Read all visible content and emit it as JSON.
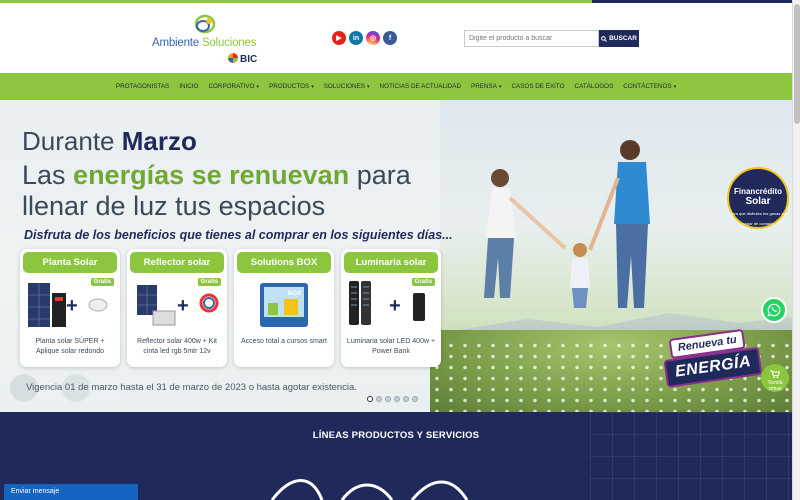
{
  "header": {
    "logo_text_part1": "Ambiente ",
    "logo_text_part2": "Soluciones",
    "logo_sub": "BIC",
    "social": [
      {
        "icon": "youtube-icon",
        "glyph": "▶"
      },
      {
        "icon": "linkedin-icon",
        "glyph": "in"
      },
      {
        "icon": "instagram-icon",
        "glyph": "◎"
      },
      {
        "icon": "facebook-icon",
        "glyph": "f"
      }
    ],
    "search": {
      "placeholder": "Digite el producto a buscar",
      "button_label": "BUSCAR"
    }
  },
  "nav": [
    {
      "label": "PROTAGONISTAS",
      "dropdown": false
    },
    {
      "label": "INICIO",
      "dropdown": false
    },
    {
      "label": "CORPORATIVO",
      "dropdown": true
    },
    {
      "label": "PRODUCTOS",
      "dropdown": true
    },
    {
      "label": "SOLUCIONES",
      "dropdown": true
    },
    {
      "label": "NOTICIAS DE ACTUALIDAD",
      "dropdown": false
    },
    {
      "label": "PRENSA",
      "dropdown": true
    },
    {
      "label": "CASOS DE ÉXITO",
      "dropdown": false
    },
    {
      "label": "CATÁLOGOS",
      "dropdown": false
    },
    {
      "label": "CONTÁCTENOS",
      "dropdown": true
    }
  ],
  "hero": {
    "line1_pre": "Durante ",
    "line1_bold": "Marzo",
    "line2_pre": "Las ",
    "line2_green": "energías se renuevan",
    "line2_post": " para",
    "line3": "llenar de luz tus espacios",
    "subtitle": "Disfruta de los beneficios que tienes al comprar en los siguientes días...",
    "cards": [
      {
        "title": "Planta Solar",
        "gratis": "Gratis",
        "desc": "Planta solar SÚPER + Aplique solar redondo"
      },
      {
        "title": "Reflector solar",
        "gratis": "Gratis",
        "desc": "Reflector solar 400w + Kit cinta led rgb 5mtr 12v"
      },
      {
        "title": "Solutions BOX",
        "gratis": "",
        "desc": "Acceso total a cursos smart"
      },
      {
        "title": "Luminaria solar",
        "gratis": "Gratis",
        "desc": "Luminaria solar LED 400w + Power Bank"
      }
    ],
    "vigencia": "Vigencia 01 de marzo hasta el 31 de marzo de 2023 o hasta agotar existencia.",
    "badge_line1": "Financrédito",
    "badge_line2": "Solar",
    "badge_small": "Para que disfrutes tus ganas sin pagar de contado",
    "renueva_line1": "Renueva tu",
    "renueva_line2": "ENERGÍA",
    "slides_total": 6,
    "slide_active": 1,
    "tienda_label": "Tienda virtual"
  },
  "products": {
    "title": "LÍNEAS PRODUCTOS Y SERVICIOS"
  },
  "chat": {
    "label": "Enviar mensaje"
  },
  "colors": {
    "green": "#8cc63f",
    "navy": "#1f2a5a"
  }
}
